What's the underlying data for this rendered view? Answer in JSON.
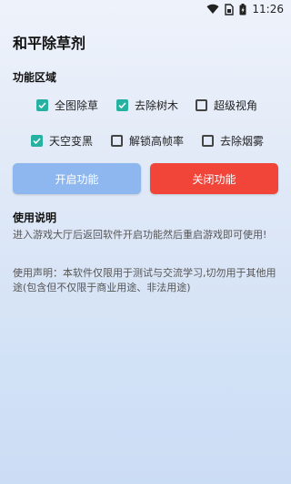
{
  "status_bar": {
    "time": "11:26",
    "icons": [
      "wifi-icon",
      "sim-card-icon",
      "battery-icon"
    ]
  },
  "app": {
    "title": "和平除草剂"
  },
  "features": {
    "section_title": "功能区域",
    "options": [
      {
        "label": "全图除草",
        "checked": true
      },
      {
        "label": "去除树木",
        "checked": true
      },
      {
        "label": "超级视角",
        "checked": false
      },
      {
        "label": "天空变黑",
        "checked": true
      },
      {
        "label": "解锁高帧率",
        "checked": false
      },
      {
        "label": "去除烟雾",
        "checked": false
      }
    ]
  },
  "actions": {
    "open_label": "开启功能",
    "close_label": "关闭功能"
  },
  "usage": {
    "section_title": "使用说明",
    "instructions": "进入游戏大厅后返回软件开启功能然后重启游戏即可使用!",
    "disclaimer": "使用声明：本软件仅限用于测试与交流学习,切勿用于其他用途(包含但不仅限于商业用途、非法用途)"
  },
  "colors": {
    "checkbox_on": "#26b1a0",
    "open_button": "#8fb7ef",
    "close_button": "#f2453a"
  }
}
